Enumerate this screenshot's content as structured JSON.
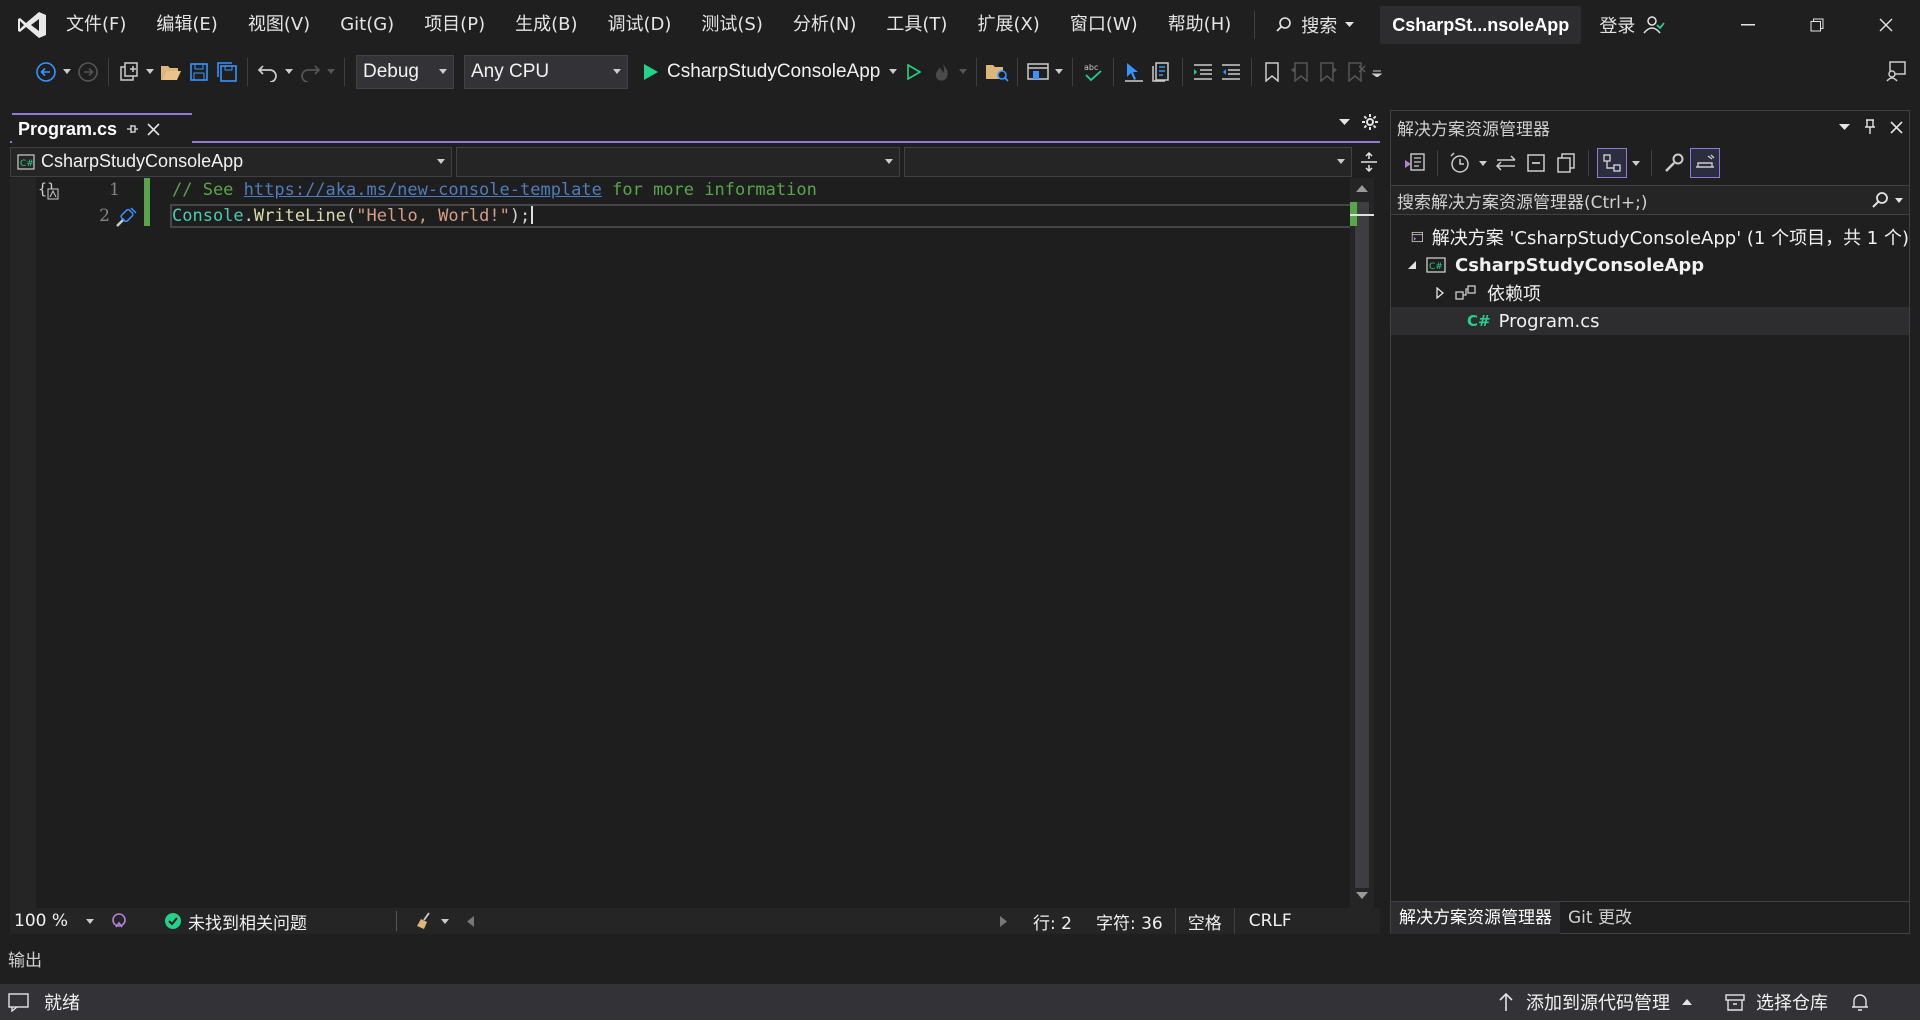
{
  "menu": {
    "items": [
      "文件(F)",
      "编辑(E)",
      "视图(V)",
      "Git(G)",
      "项目(P)",
      "生成(B)",
      "调试(D)",
      "测试(S)",
      "分析(N)",
      "工具(T)",
      "扩展(X)",
      "窗口(W)",
      "帮助(H)"
    ],
    "search_label": "搜索",
    "solution_title": "CsharpSt...nsoleApp",
    "login_label": "登录"
  },
  "toolbar": {
    "configuration": "Debug",
    "platform": "Any CPU",
    "startup_project": "CsharpStudyConsoleApp"
  },
  "editor": {
    "tab_label": "Program.cs",
    "nav_project": "CsharpStudyConsoleApp",
    "nav_type": "",
    "nav_member": "",
    "lines": [
      {
        "num": "1",
        "comment_pre": "// See ",
        "url": "https://aka.ms/new-console-template",
        "comment_post": " for more information"
      },
      {
        "num": "2",
        "cls": "Console",
        "dot": ".",
        "method": "WriteLine",
        "open": "(",
        "str": "\"Hello, World!\"",
        "close": ");"
      }
    ],
    "zoom": "100 %",
    "issues": "未找到相关问题",
    "line_pos": "行: 2",
    "char_pos": "字符: 36",
    "whitespace": "空格",
    "line_ending": "CRLF"
  },
  "solution_explorer": {
    "title": "解决方案资源管理器",
    "search_placeholder": "搜索解决方案资源管理器(Ctrl+;)",
    "solution_label": "解决方案 'CsharpStudyConsoleApp' (1 个项目，共 1 个)",
    "project_label": "CsharpStudyConsoleApp",
    "dependencies_label": "依赖项",
    "file_label": "Program.cs",
    "file_icon_text": "C#",
    "project_icon_text": "C#",
    "tabs": [
      "解决方案资源管理器",
      "Git 更改"
    ]
  },
  "output": {
    "label": "输出"
  },
  "status": {
    "ready": "就绪",
    "add_source_control": "添加到源代码管理",
    "select_repo": "选择仓库"
  },
  "colors": {
    "accent": "#8e7bd6",
    "comment": "#57a64a",
    "class": "#4ec9b0",
    "method": "#dcdcaa",
    "string": "#d69d85",
    "run_green": "#23d18b"
  }
}
